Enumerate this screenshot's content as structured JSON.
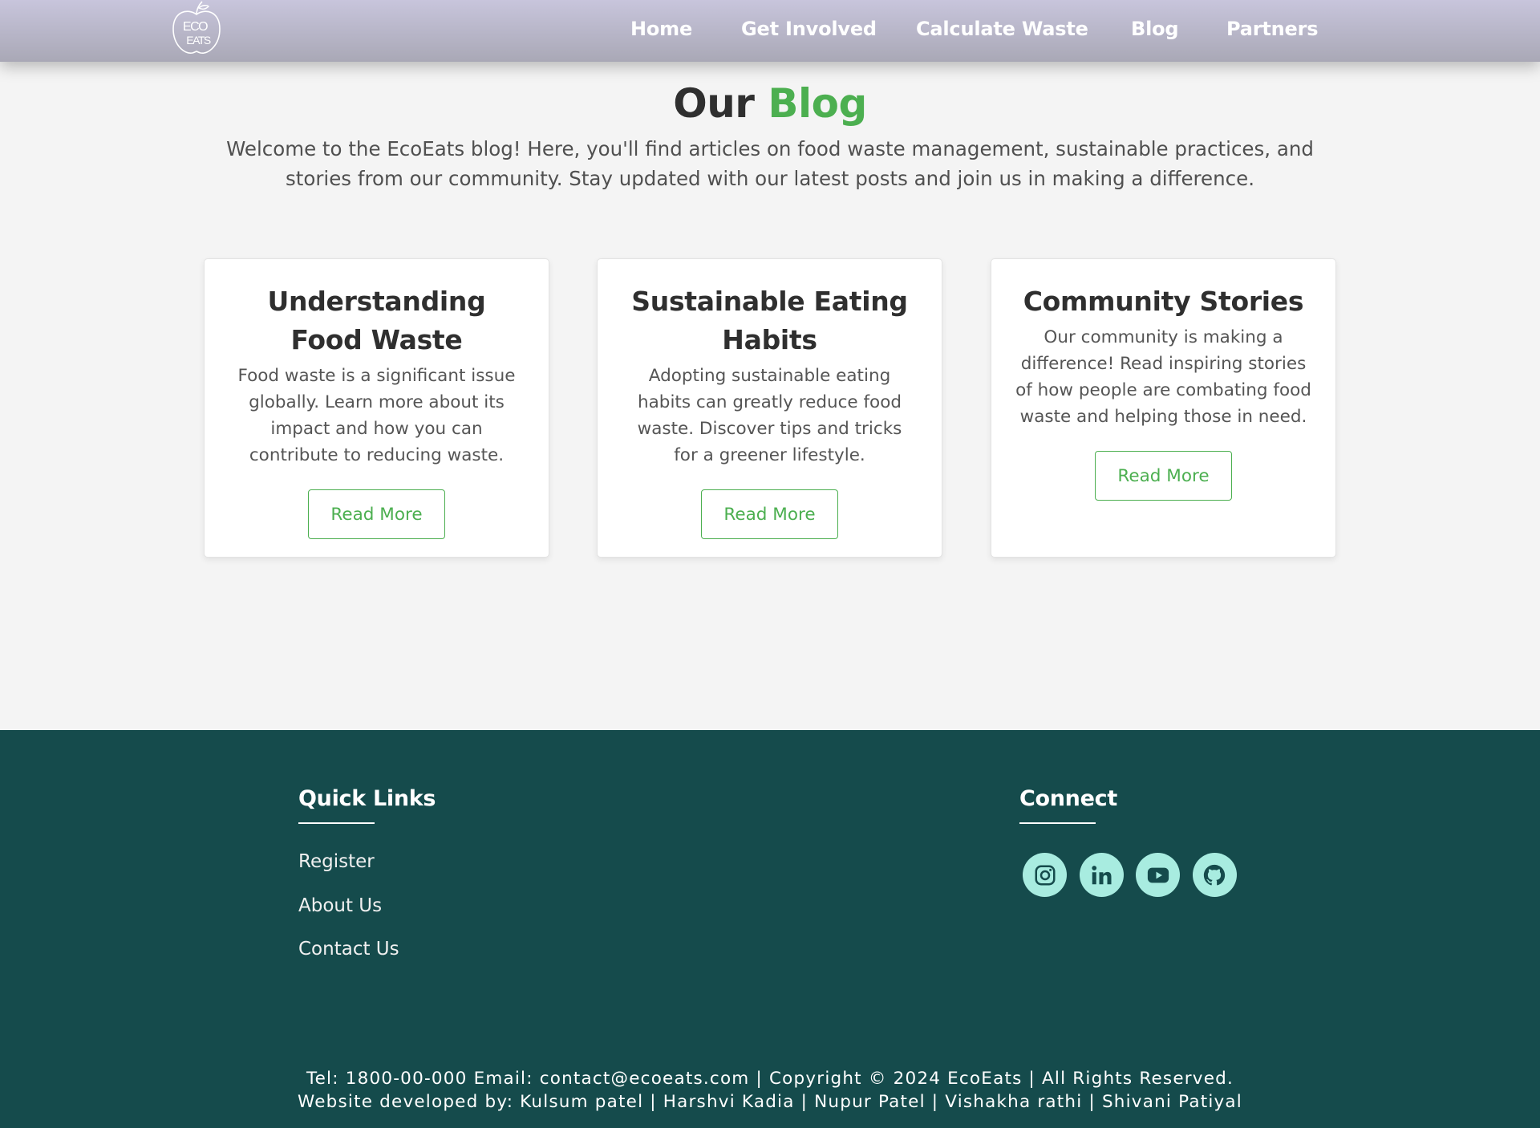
{
  "header": {
    "logo_text_top": "ECO",
    "logo_text_bottom": "EATS",
    "nav": {
      "home": "Home",
      "get_involved": "Get Involved",
      "calculate_waste": "Calculate Waste",
      "blog": "Blog",
      "partners": "Partners"
    }
  },
  "main": {
    "title_prefix": "Our",
    "title_accent": "Blog",
    "intro": "Welcome to the EcoEats blog! Here, you'll find articles on food waste management, sustainable practices, and stories from our community. Stay updated with our latest posts and join us in making a difference.",
    "cards": [
      {
        "title": "Understanding Food Waste",
        "text": "Food waste is a significant issue globally. Learn more about its impact and how you can contribute to reducing waste.",
        "button": "Read More"
      },
      {
        "title": "Sustainable Eating Habits",
        "text": "Adopting sustainable eating habits can greatly reduce food waste. Discover tips and tricks for a greener lifestyle.",
        "button": "Read More"
      },
      {
        "title": "Community Stories",
        "text": "Our community is making a difference! Read inspiring stories of how people are combating food waste and helping those in need.",
        "button": "Read More"
      }
    ]
  },
  "footer": {
    "quick_links_title": "Quick Links",
    "quick_links": [
      "Register",
      "About Us",
      "Contact Us"
    ],
    "connect_title": "Connect",
    "socials": [
      "instagram-icon",
      "linkedin-icon",
      "youtube-icon",
      "github-icon"
    ],
    "line1": "Tel: 1800-00-000 Email: contact@ecoeats.com | Copyright © 2024 EcoEats | All Rights Reserved.",
    "line2": "Website developed by: Kulsum patel | Harshvi Kadia | Nupur Patel | Vishakha rathi | Shivani Patiyal"
  },
  "colors": {
    "accent": "#4caf50",
    "footer_bg": "#154b4c",
    "social_bg": "#a8ece0",
    "header_top": "#c8c5dc",
    "header_bottom": "#a9a8b6"
  }
}
